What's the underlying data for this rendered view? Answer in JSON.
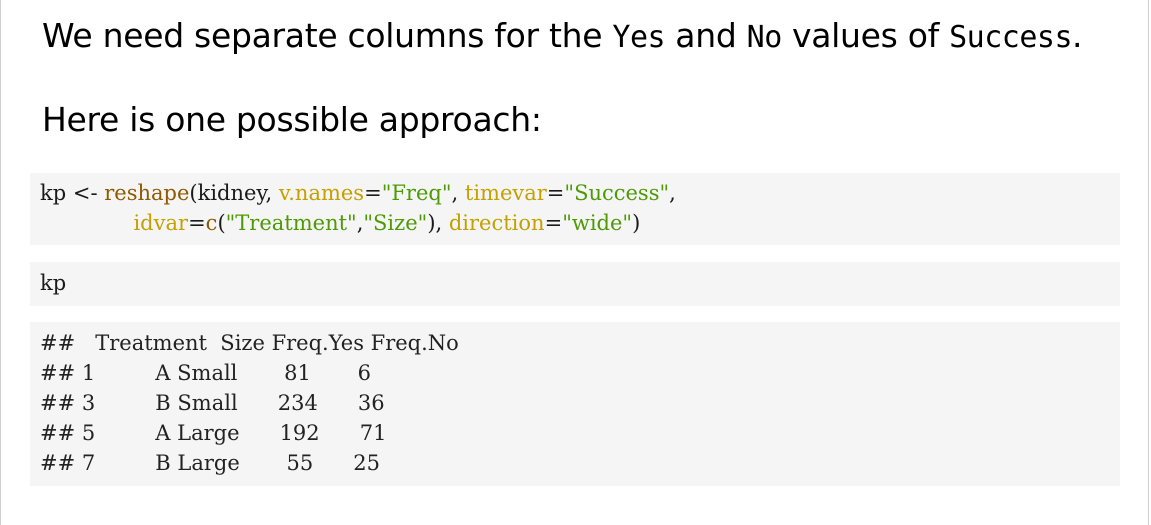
{
  "slide": {
    "line1": {
      "part1": "We need separate columns for the ",
      "code1": "Yes",
      "part2": " and ",
      "code2": "No",
      "part3": " values of ",
      "code3": "Success",
      "part4": "."
    },
    "line2": "Here is one possible approach:"
  },
  "code": {
    "l1": {
      "var": "kp ",
      "assign": "<-",
      "sp": " ",
      "func": "reshape",
      "open": "(kidney, ",
      "vnames_arg": "v.names",
      "eq1": "=",
      "vnames_val": "\"Freq\"",
      "comma1": ", ",
      "timevar_arg": "timevar",
      "eq2": "=",
      "timevar_val": "\"Success\"",
      "comma2": ","
    },
    "l2": {
      "indent": "              ",
      "idvar_arg": "idvar",
      "eq": "=",
      "c_func": "c",
      "open": "(",
      "v1": "\"Treatment\"",
      "comma": ",",
      "v2": "\"Size\"",
      "close": "), ",
      "dir_arg": "direction",
      "eq2": "=",
      "dir_val": "\"wide\"",
      "end": ")"
    },
    "print_line": "kp"
  },
  "output": {
    "lines": [
      "##   Treatment  Size Freq.Yes Freq.No",
      "## 1         A Small       81       6",
      "## 3         B Small      234      36",
      "## 5         A Large      192      71",
      "## 7         B Large       55      25"
    ]
  }
}
